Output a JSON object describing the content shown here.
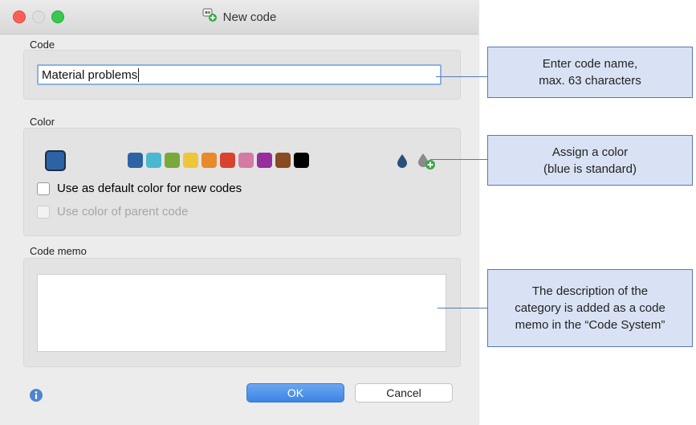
{
  "window": {
    "title": "New code"
  },
  "code_section": {
    "label": "Code",
    "input_value": "Material problems"
  },
  "color_section": {
    "label": "Color",
    "selected_color": "#2c63a5",
    "swatches": [
      "#2c63a5",
      "#4ab9cf",
      "#7aa83a",
      "#eec63a",
      "#e88a2b",
      "#d9432d",
      "#d57aa3",
      "#962e9b",
      "#8a4a22",
      "#000000"
    ],
    "default_checkbox_label": "Use as default color for new codes",
    "parent_checkbox_label": "Use color of parent code"
  },
  "memo_section": {
    "label": "Code memo"
  },
  "buttons": {
    "ok": "OK",
    "cancel": "Cancel"
  },
  "callouts": {
    "code_name": {
      "line1": "Enter code name,",
      "line2": "max. 63 characters"
    },
    "color": {
      "line1": "Assign a color",
      "line2": "(blue is standard)"
    },
    "memo": {
      "line1": "The description of the",
      "line2": "category is added as a code",
      "line3": "memo in the “Code System”"
    }
  },
  "colors": {
    "callout_fill": "#d9e2f4",
    "callout_border": "#5579b3",
    "ok_button": "#4a8ee8"
  }
}
